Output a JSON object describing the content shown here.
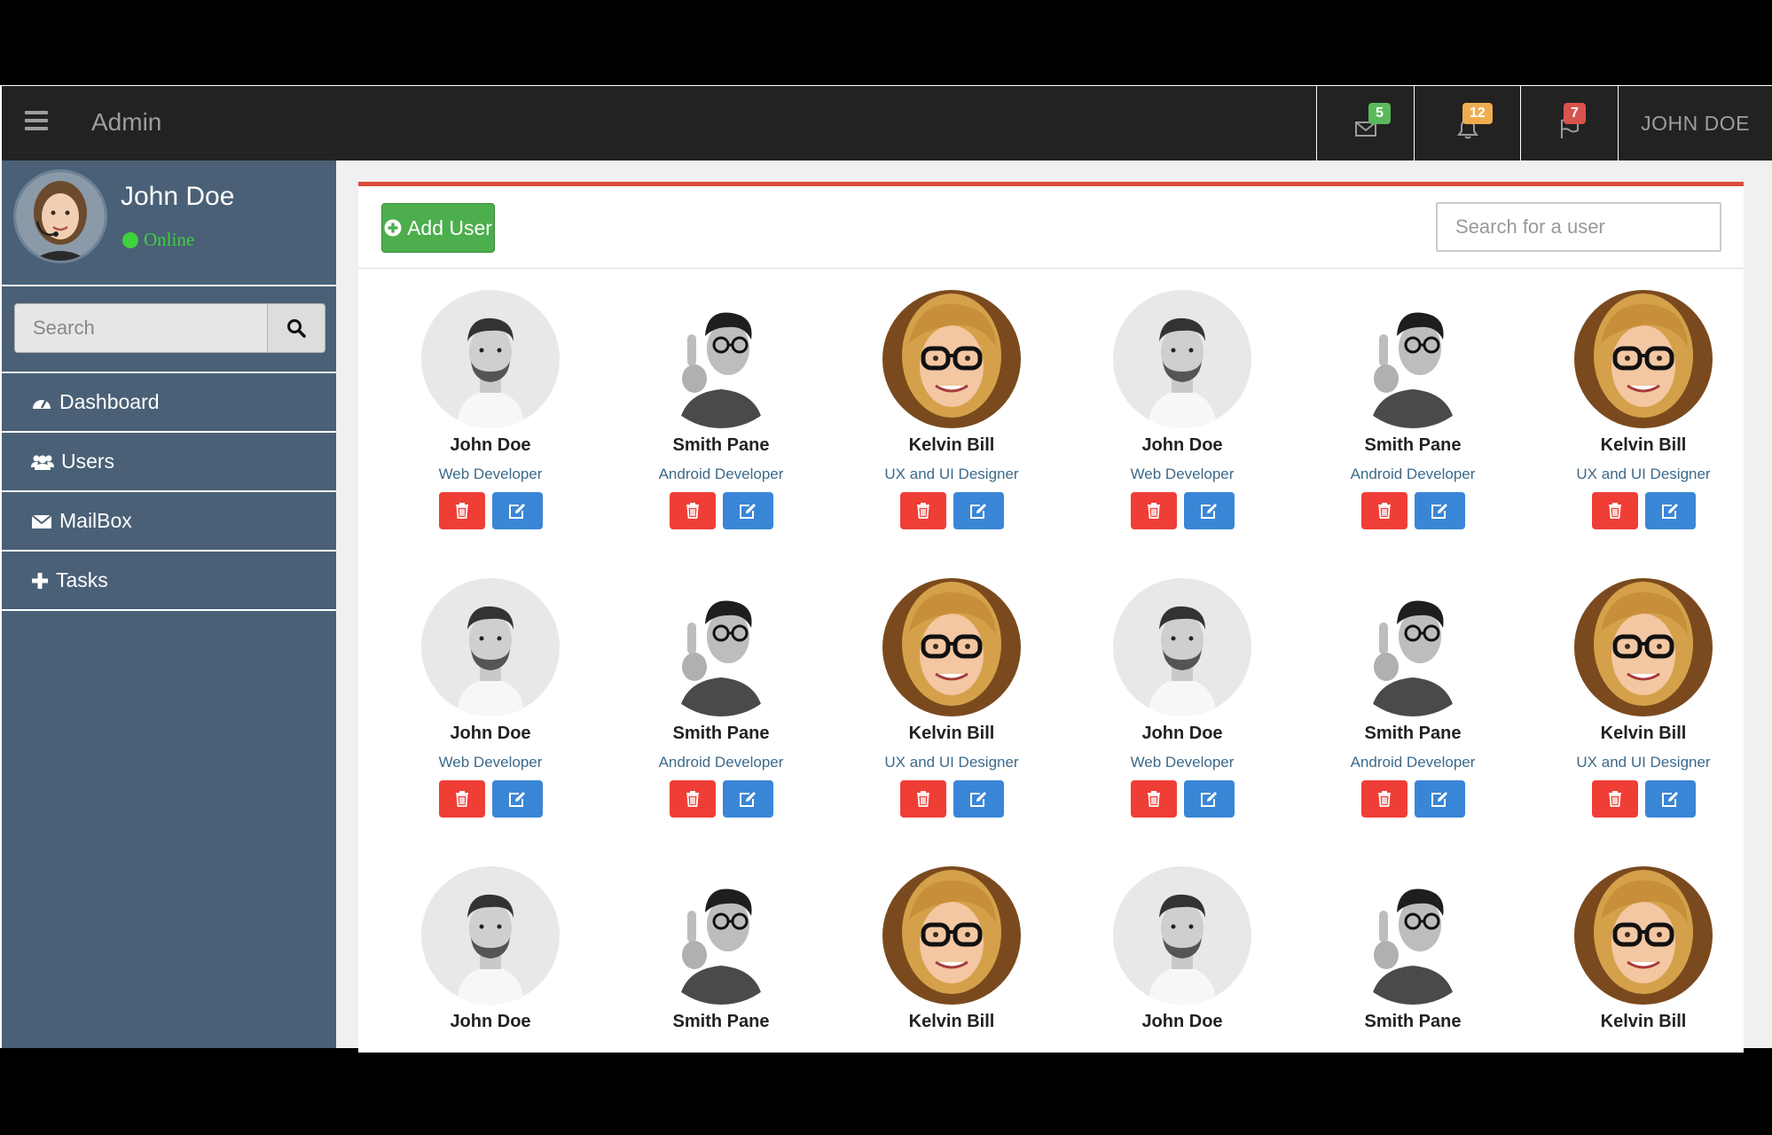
{
  "navbar": {
    "brand": "Admin",
    "badges": {
      "mail": "5",
      "notifications": "12",
      "flags": "7"
    },
    "user": "JOHN DOE"
  },
  "sidebar": {
    "profile_name": "John Doe",
    "status": "Online",
    "search_placeholder": "Search",
    "items": [
      {
        "label": "Dashboard",
        "icon": "dashboard-icon"
      },
      {
        "label": "Users",
        "icon": "users-icon"
      },
      {
        "label": "MailBox",
        "icon": "envelope-icon"
      },
      {
        "label": "Tasks",
        "icon": "plus-icon"
      }
    ]
  },
  "main": {
    "add_user_label": "Add User",
    "search_placeholder": "Search for a user",
    "users": [
      {
        "name": "John Doe",
        "role": "Web Developer",
        "avatar": "man-beard"
      },
      {
        "name": "Smith Pane",
        "role": "Android Developer",
        "avatar": "man-glasses"
      },
      {
        "name": "Kelvin Bill",
        "role": "UX and UI Designer",
        "avatar": "woman-glasses"
      },
      {
        "name": "John Doe",
        "role": "Web Developer",
        "avatar": "man-beard"
      },
      {
        "name": "Smith Pane",
        "role": "Android Developer",
        "avatar": "man-glasses"
      },
      {
        "name": "Kelvin Bill",
        "role": "UX and UI Designer",
        "avatar": "woman-glasses"
      },
      {
        "name": "John Doe",
        "role": "Web Developer",
        "avatar": "man-beard"
      },
      {
        "name": "Smith Pane",
        "role": "Android Developer",
        "avatar": "man-glasses"
      },
      {
        "name": "Kelvin Bill",
        "role": "UX and UI Designer",
        "avatar": "woman-glasses"
      },
      {
        "name": "John Doe",
        "role": "Web Developer",
        "avatar": "man-beard"
      },
      {
        "name": "Smith Pane",
        "role": "Android Developer",
        "avatar": "man-glasses"
      },
      {
        "name": "Kelvin Bill",
        "role": "UX and UI Designer",
        "avatar": "woman-glasses"
      },
      {
        "name": "John Doe",
        "role": "",
        "avatar": "man-beard"
      },
      {
        "name": "Smith Pane",
        "role": "",
        "avatar": "man-glasses"
      },
      {
        "name": "Kelvin Bill",
        "role": "",
        "avatar": "woman-glasses"
      },
      {
        "name": "John Doe",
        "role": "",
        "avatar": "man-beard"
      },
      {
        "name": "Smith Pane",
        "role": "",
        "avatar": "man-glasses"
      },
      {
        "name": "Kelvin Bill",
        "role": "",
        "avatar": "woman-glasses"
      }
    ]
  },
  "colors": {
    "navbar": "#222222",
    "sidebar": "#4a6076",
    "accent_top": "#dd4b39",
    "add_button": "#4cae4c",
    "delete_button": "#ef3e36",
    "edit_button": "#3a86d6",
    "online": "#3fd13f"
  }
}
